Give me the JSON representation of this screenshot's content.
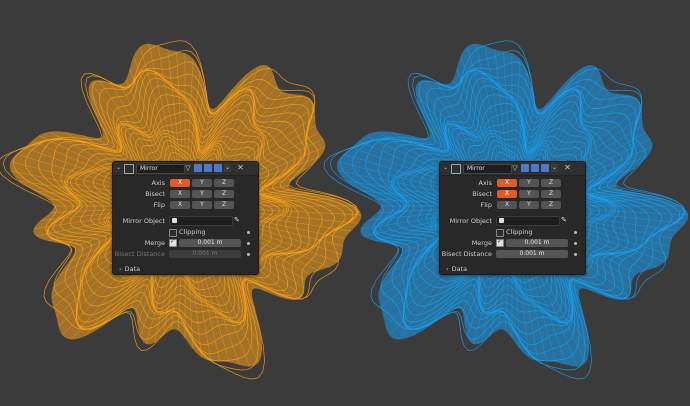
{
  "colors": {
    "left_mesh": "#f7a11a",
    "right_mesh": "#1a9ff0",
    "background": "#3b3b3b",
    "accent": "#e05a2a"
  },
  "panels": [
    {
      "modifier_name": "Mirror",
      "rows": {
        "axis_label": "Axis",
        "bisect_label": "Bisect",
        "flip_label": "Flip",
        "x": "X",
        "y": "Y",
        "z": "Z",
        "mirror_object_label": "Mirror Object",
        "clipping_label": "Clipping",
        "merge_label": "Merge",
        "merge_value": "0.001 m",
        "bisect_distance_label": "Bisect Distance",
        "bisect_distance_value": "0.001 m",
        "data_label": "Data"
      }
    },
    {
      "modifier_name": "Mirror",
      "rows": {
        "axis_label": "Axis",
        "bisect_label": "Bisect",
        "flip_label": "Flip",
        "x": "X",
        "y": "Y",
        "z": "Z",
        "mirror_object_label": "Mirror Object",
        "clipping_label": "Clipping",
        "merge_label": "Merge",
        "merge_value": "0.001 m",
        "bisect_distance_label": "Bisect Distance",
        "bisect_distance_value": "0.001 m",
        "data_label": "Data"
      }
    }
  ]
}
